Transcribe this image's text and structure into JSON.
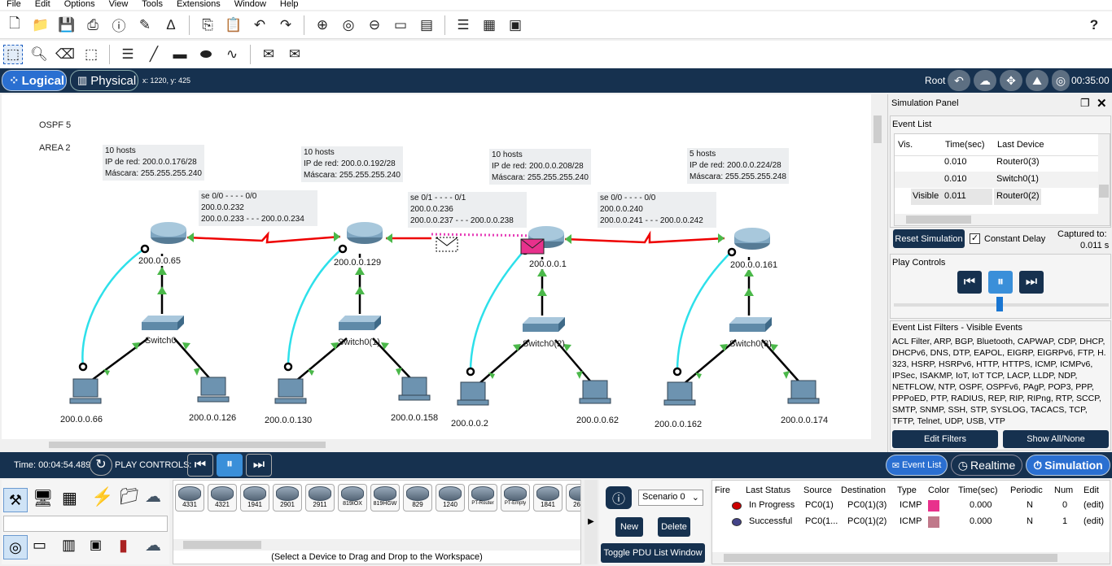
{
  "menu": [
    "File",
    "Edit",
    "Options",
    "View",
    "Tools",
    "Extensions",
    "Window",
    "Help"
  ],
  "toolbar1_icons": [
    "new-file-icon",
    "open-folder-icon",
    "save-icon",
    "print-icon",
    "info-icon",
    "activity-wizard-icon",
    "pt-icon",
    "copy-icon",
    "paste-icon",
    "undo-icon",
    "redo-icon",
    "zoom-in-icon",
    "zoom-reset-icon",
    "zoom-out-icon",
    "drawing-palette-icon",
    "custom-device-icon",
    "notes-icon",
    "viewport-icon",
    "image-icon"
  ],
  "toolbar1_help": "?",
  "toolbar2_icons": [
    "select-icon",
    "inspect-icon",
    "delete-icon",
    "resize-icon",
    "note-icon",
    "line-icon",
    "rectangle-icon",
    "ellipse-icon",
    "freeform-icon",
    "simple-pdu-icon",
    "complex-pdu-icon"
  ],
  "tabs": {
    "logical": "Logical",
    "physical": "Physical",
    "coords": "x: 1220, y: 425",
    "root": "Root",
    "clock": "00:35:00"
  },
  "workspace": {
    "notes": [
      "OSPF 5",
      "AREA 2"
    ],
    "subnets": [
      {
        "hosts": "10 hosts",
        "net": "IP de red: 200.0.0.176/28",
        "mask": "Máscara: 255.255.255.240"
      },
      {
        "hosts": "10 hosts",
        "net": "IP de red: 200.0.0.192/28",
        "mask": "Máscara: 255.255.255.240"
      },
      {
        "hosts": "10 hosts",
        "net": "IP de red: 200.0.0.208/28",
        "mask": "Máscara: 255.255.255.240"
      },
      {
        "hosts": "5 hosts",
        "net": "IP de red: 200.0.0.224/28",
        "mask": "Máscara: 255.255.255.248"
      }
    ],
    "links": [
      {
        "l1": "se 0/0 - - - - 0/0",
        "l2": "200.0.0.232",
        "l3": "200.0.0.233 - - - 200.0.0.234"
      },
      {
        "l1": "se 0/1 - - - - 0/1",
        "l2": "200.0.0.236",
        "l3": "200.0.0.237 - - - 200.0.0.238"
      },
      {
        "l1": "se 0/0 - - - - 0/0",
        "l2": "200.0.0.240",
        "l3": "200.0.0.241 - - - 200.0.0.242"
      }
    ],
    "routers": [
      "200.0.0.65",
      "200.0.0.129",
      "200.0.0.1",
      "200.0.0.161"
    ],
    "switches": [
      "Switch0",
      "Switch0(1)",
      "Switch0(2)",
      "Switch0(3)"
    ],
    "pcs": [
      "200.0.0.66",
      "200.0.0.126",
      "200.0.0.130",
      "200.0.0.158",
      "200.0.0.2",
      "200.0.0.62",
      "200.0.0.162",
      "200.0.0.174"
    ]
  },
  "sim": {
    "title": "Simulation Panel",
    "event_list": "Event List",
    "headers": [
      "Vis.",
      "Time(sec)",
      "Last Device"
    ],
    "events": [
      {
        "vis": "",
        "time": "0.010",
        "device": "Router0(3)"
      },
      {
        "vis": "",
        "time": "0.010",
        "device": "Switch0(1)"
      },
      {
        "vis": "Visible",
        "time": "0.011",
        "device": "Router0(2)"
      }
    ],
    "reset": "Reset Simulation",
    "constant_delay": "Constant Delay",
    "captured": "Captured to:",
    "captured_val": "0.011 s",
    "play_controls": "Play Controls",
    "filters_title": "Event List Filters - Visible Events",
    "filters_text": "ACL Filter, ARP, BGP, Bluetooth, CAPWAP, CDP, DHCP, DHCPv6, DNS, DTP, EAPOL, EIGRP, EIGRPv6, FTP, H. 323, HSRP, HSRPv6, HTTP, HTTPS, ICMP, ICMPv6, IPSec, ISAKMP, IoT, IoT TCP, LACP, LLDP, NDP, NETFLOW, NTP, OSPF, OSPFv6, PAgP, POP3, PPP, PPPoED, PTP, RADIUS, REP, RIP, RIPng, RTP, SCCP, SMTP, SNMP, SSH, STP, SYSLOG, TACACS, TCP, TFTP, Telnet, UDP, USB, VTP",
    "edit_filters": "Edit Filters",
    "show_all": "Show All/None"
  },
  "status": {
    "time": "Time: 00:04:54.489",
    "play_controls": "PLAY CONTROLS:",
    "event_list": "Event List",
    "realtime": "Realtime",
    "simulation": "Simulation"
  },
  "devices": [
    "4331",
    "4321",
    "1941",
    "2901",
    "2911",
    "819IOX",
    "819HGW",
    "829",
    "1240",
    "PT-Router",
    "PT-Empty",
    "1841",
    "2620"
  ],
  "device_hint": "(Select a Device to Drag and Drop to the Workspace)",
  "scenario": {
    "select": "Scenario 0",
    "new": "New",
    "delete": "Delete",
    "toggle": "Toggle PDU List Window"
  },
  "pdu": {
    "headers": [
      "Fire",
      "Last Status",
      "Source",
      "Destination",
      "Type",
      "Color",
      "Time(sec)",
      "Periodic",
      "Num",
      "Edit"
    ],
    "rows": [
      {
        "status": "In Progress",
        "source": "PC0(1)",
        "dest": "PC0(1)(3)",
        "type": "ICMP",
        "color": "#e8318c",
        "time": "0.000",
        "periodic": "N",
        "num": "0",
        "edit": "(edit)"
      },
      {
        "status": "Successful",
        "source": "PC0(1...",
        "dest": "PC0(1)(2)",
        "type": "ICMP",
        "color": "#c0788a",
        "time": "0.000",
        "periodic": "N",
        "num": "1",
        "edit": "(edit)"
      }
    ]
  }
}
